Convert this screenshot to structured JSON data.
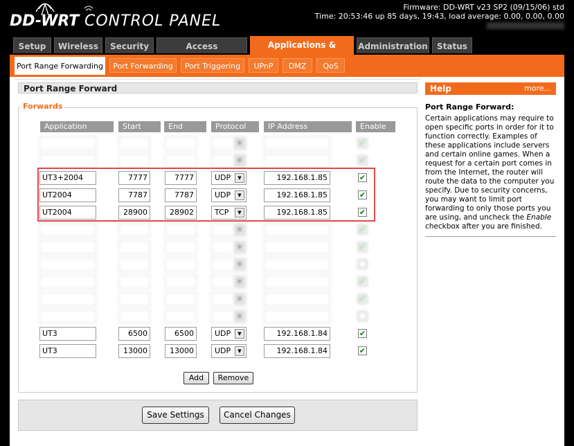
{
  "header": {
    "logo": "DD-WRT",
    "title": "CONTROL PANEL",
    "firmware": "Firmware: DD-WRT v23 SP2 (09/15/06) std",
    "time": "Time: 20:53:46 up 85 days, 19:43, load average: 0.00, 0.00, 0.00"
  },
  "top_tabs": [
    {
      "label": "Setup"
    },
    {
      "label": "Wireless"
    },
    {
      "label": "Security"
    },
    {
      "label": "Access Restrictions"
    },
    {
      "label": "Applications & Gaming",
      "active": true
    },
    {
      "label": "Administration"
    },
    {
      "label": "Status"
    }
  ],
  "sub_tabs": [
    {
      "label": "Port Range Forwarding",
      "active": true
    },
    {
      "label": "Port Forwarding"
    },
    {
      "label": "Port Triggering"
    },
    {
      "label": "UPnP"
    },
    {
      "label": "DMZ"
    },
    {
      "label": "QoS"
    }
  ],
  "section_title": "Port Range Forward",
  "forwards": {
    "legend": "Forwards",
    "columns": [
      "Application",
      "Start",
      "End",
      "Protocol",
      "IP Address",
      "Enable"
    ],
    "rows": [
      {
        "application": "",
        "start": "",
        "end": "",
        "protocol": "",
        "ip": "",
        "enable": true,
        "obscured": true
      },
      {
        "application": "",
        "start": "",
        "end": "",
        "protocol": "",
        "ip": "",
        "enable": true,
        "obscured": true
      },
      {
        "application": "UT3+2004",
        "start": "7777",
        "end": "7777",
        "protocol": "UDP",
        "ip": "192.168.1.85",
        "enable": true
      },
      {
        "application": "UT2004",
        "start": "7787",
        "end": "7787",
        "protocol": "UDP",
        "ip": "192.168.1.85",
        "enable": true
      },
      {
        "application": "UT2004",
        "start": "28900",
        "end": "28902",
        "protocol": "TCP",
        "ip": "192.168.1.85",
        "enable": true
      },
      {
        "application": "",
        "start": "",
        "end": "",
        "protocol": "",
        "ip": "",
        "enable": true,
        "obscured": true
      },
      {
        "application": "",
        "start": "",
        "end": "",
        "protocol": "",
        "ip": "",
        "enable": true,
        "obscured": true
      },
      {
        "application": "",
        "start": "",
        "end": "",
        "protocol": "",
        "ip": "",
        "enable": false,
        "obscured": true
      },
      {
        "application": "",
        "start": "",
        "end": "",
        "protocol": "",
        "ip": "",
        "enable": true,
        "obscured": true
      },
      {
        "application": "",
        "start": "",
        "end": "",
        "protocol": "",
        "ip": "",
        "enable": true,
        "obscured": true
      },
      {
        "application": "",
        "start": "",
        "end": "",
        "protocol": "",
        "ip": "",
        "enable": false,
        "obscured": true
      },
      {
        "application": "UT3",
        "start": "6500",
        "end": "6500",
        "protocol": "UDP",
        "ip": "192.168.1.84",
        "enable": true
      },
      {
        "application": "UT3",
        "start": "13000",
        "end": "13000",
        "protocol": "UDP",
        "ip": "192.168.1.84",
        "enable": true
      }
    ],
    "add_label": "Add",
    "remove_label": "Remove"
  },
  "footer": {
    "save_label": "Save Settings",
    "cancel_label": "Cancel Changes"
  },
  "help": {
    "title": "Help",
    "more": "more...",
    "heading": "Port Range Forward:",
    "text_before": "Certain applications may require to open specific ports in order for it to function correctly. Examples of these applications include servers and certain online games. When a request for a certain port comes in from the Internet, the router will route the data to the computer you specify. Due to security concerns, you may want to limit port forwarding to only those ports you are using, and uncheck the ",
    "text_em": "Enable",
    "text_after": " checkbox after you are finished."
  },
  "colors": {
    "accent": "#f26b1d",
    "check": "#0a7a0a",
    "highlight": "#e04848"
  }
}
